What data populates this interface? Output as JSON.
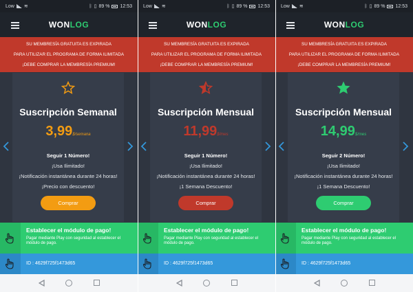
{
  "status_bar": {
    "carrier": "Low",
    "battery": "89 %",
    "time": "12:53"
  },
  "app": {
    "logo_part1": "WON",
    "logo_part2": "LOG"
  },
  "banner": {
    "line1": "SU MEMBRESÍA GRATUITA ES EXPIRADA",
    "line2": "PARA UTILIZAR EL PROGRAMA DE FORMA ILIMITADA",
    "line3": "¡DEBE COMPRAR LA MEMBRESÍA PREMIUM!"
  },
  "plans": [
    {
      "title": "Suscripción Semanal",
      "price": "3,99",
      "unit": "$/semana",
      "features": [
        "Seguir 1 Número!",
        "¡Usa Ilimitado!",
        "¡Notificación instantánea durante 24 horas!",
        "¡Precio con descuento!"
      ],
      "button": "Comprar",
      "color": "#f39c12",
      "star_fill": "empty"
    },
    {
      "title": "Suscripción Mensual",
      "price": "11,99",
      "unit": "$/mes",
      "features": [
        "Seguir 1 Número!",
        "¡Usa Ilimitado!",
        "¡Notificación instantánea durante 24 horas!",
        "¡1 Semana Descuento!"
      ],
      "button": "Comprar",
      "color": "#c0392b",
      "star_fill": "half"
    },
    {
      "title": "Suscripción Mensual",
      "price": "14,99",
      "unit": "$/mes",
      "features": [
        "Seguir 2 Número!",
        "¡Usa Ilimitado!",
        "¡Notificación instantánea durante 24 horas!",
        "¡1 Semana Descuento!"
      ],
      "button": "Comprar",
      "color": "#2ecc71",
      "star_fill": "full"
    }
  ],
  "payment": {
    "title": "Establecer el módulo de pago!",
    "description": "Pagar mediante Play con seguridad al establecer el módulo de pago."
  },
  "id_bar": {
    "text": "ID : 4629f725f1473d65"
  },
  "icons": {
    "menu": "hamburger-icon",
    "star": "star-icon",
    "prev": "chevron-left-icon",
    "next": "chevron-right-icon",
    "hand": "hand-pointer-icon",
    "nav_back": "back-triangle-icon",
    "nav_home": "home-circle-icon",
    "nav_recent": "recent-square-icon"
  },
  "colors": {
    "banner": "#c0392b",
    "accent_green": "#2ecc71",
    "id_bar": "#3498db",
    "background": "#2f3540",
    "card": "#363d4a"
  }
}
